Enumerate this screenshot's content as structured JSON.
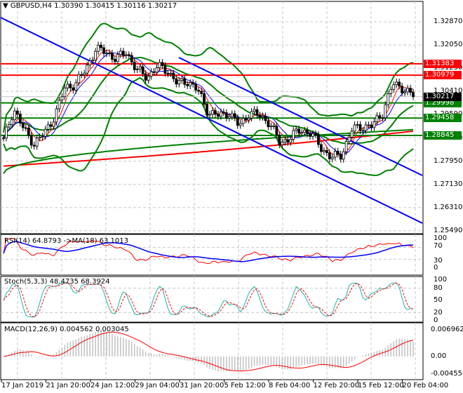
{
  "header": {
    "symbol": "GBPUSD,H4",
    "ohlc": "1.30390 1.30415 1.30116 1.30217"
  },
  "price_axis": {
    "ticks": [
      "1.32870",
      "1.32050",
      "1.31230",
      "1.30410",
      "1.29590",
      "1.28770",
      "1.27950",
      "1.27130",
      "1.26310",
      "1.25490"
    ],
    "current": "1.30217"
  },
  "levels": [
    {
      "value": "1.31383",
      "color": "#ff0000"
    },
    {
      "value": "1.30979",
      "color": "#ff0000"
    },
    {
      "value": "1.29998",
      "color": "#008000"
    },
    {
      "value": "1.29458",
      "color": "#008000"
    },
    {
      "value": "1.28845",
      "color": "#008000"
    }
  ],
  "rsi": {
    "label": "RSI(14) 64.8793  ->MA(18) 63.1013",
    "ticks": [
      "100",
      "70",
      "30",
      "0"
    ]
  },
  "stoch": {
    "label": "Stoch(5,3,3) 48.4735 68.3924",
    "ticks": [
      "100",
      "80",
      "50",
      "20",
      "0"
    ]
  },
  "macd": {
    "label": "MACD(12,26,9) 0.004562 0.003045",
    "ticks": [
      "0.006962",
      "0.00",
      "-0.004556"
    ]
  },
  "time_axis": [
    "17 Jan 2019",
    "21 Jan 20:00",
    "24 Jan 12:00",
    "29 Jan 04:00",
    "31 Jan 20:00",
    "5 Feb 12:00",
    "8 Feb 04:00",
    "12 Feb 20:00",
    "15 Feb 12:00",
    "20 Feb 04:00"
  ],
  "colors": {
    "bull": "#000000",
    "bear": "#000000",
    "bands": "#008000",
    "channel": "#0000ff",
    "rsi": "#ff0000",
    "rsi_ma": "#0000ff",
    "stoch_main": "#20b2aa",
    "stoch_signal": "#ff0000",
    "macd_hist": "#c0c0c0",
    "macd_signal": "#ff0000"
  },
  "chart_data": {
    "type": "candlestick",
    "key_closes": [
      1.2867,
      1.2979,
      1.2904,
      1.2855,
      1.2892,
      1.2954,
      1.3053,
      1.3066,
      1.3116,
      1.319,
      1.318,
      1.3155,
      1.318,
      1.3116,
      1.3091,
      1.3128,
      1.3116,
      1.3066,
      1.3078,
      1.3041,
      1.2966,
      1.2954,
      1.2966,
      1.2917,
      1.2966,
      1.2954,
      1.2929,
      1.2855,
      1.2879,
      1.2904,
      1.2892,
      1.2842,
      1.2805,
      1.2817,
      1.2904,
      1.2917,
      1.2917,
      1.2966,
      1.3066,
      1.3053,
      1.30217
    ],
    "ylim": [
      1.2549,
      1.3287
    ]
  }
}
